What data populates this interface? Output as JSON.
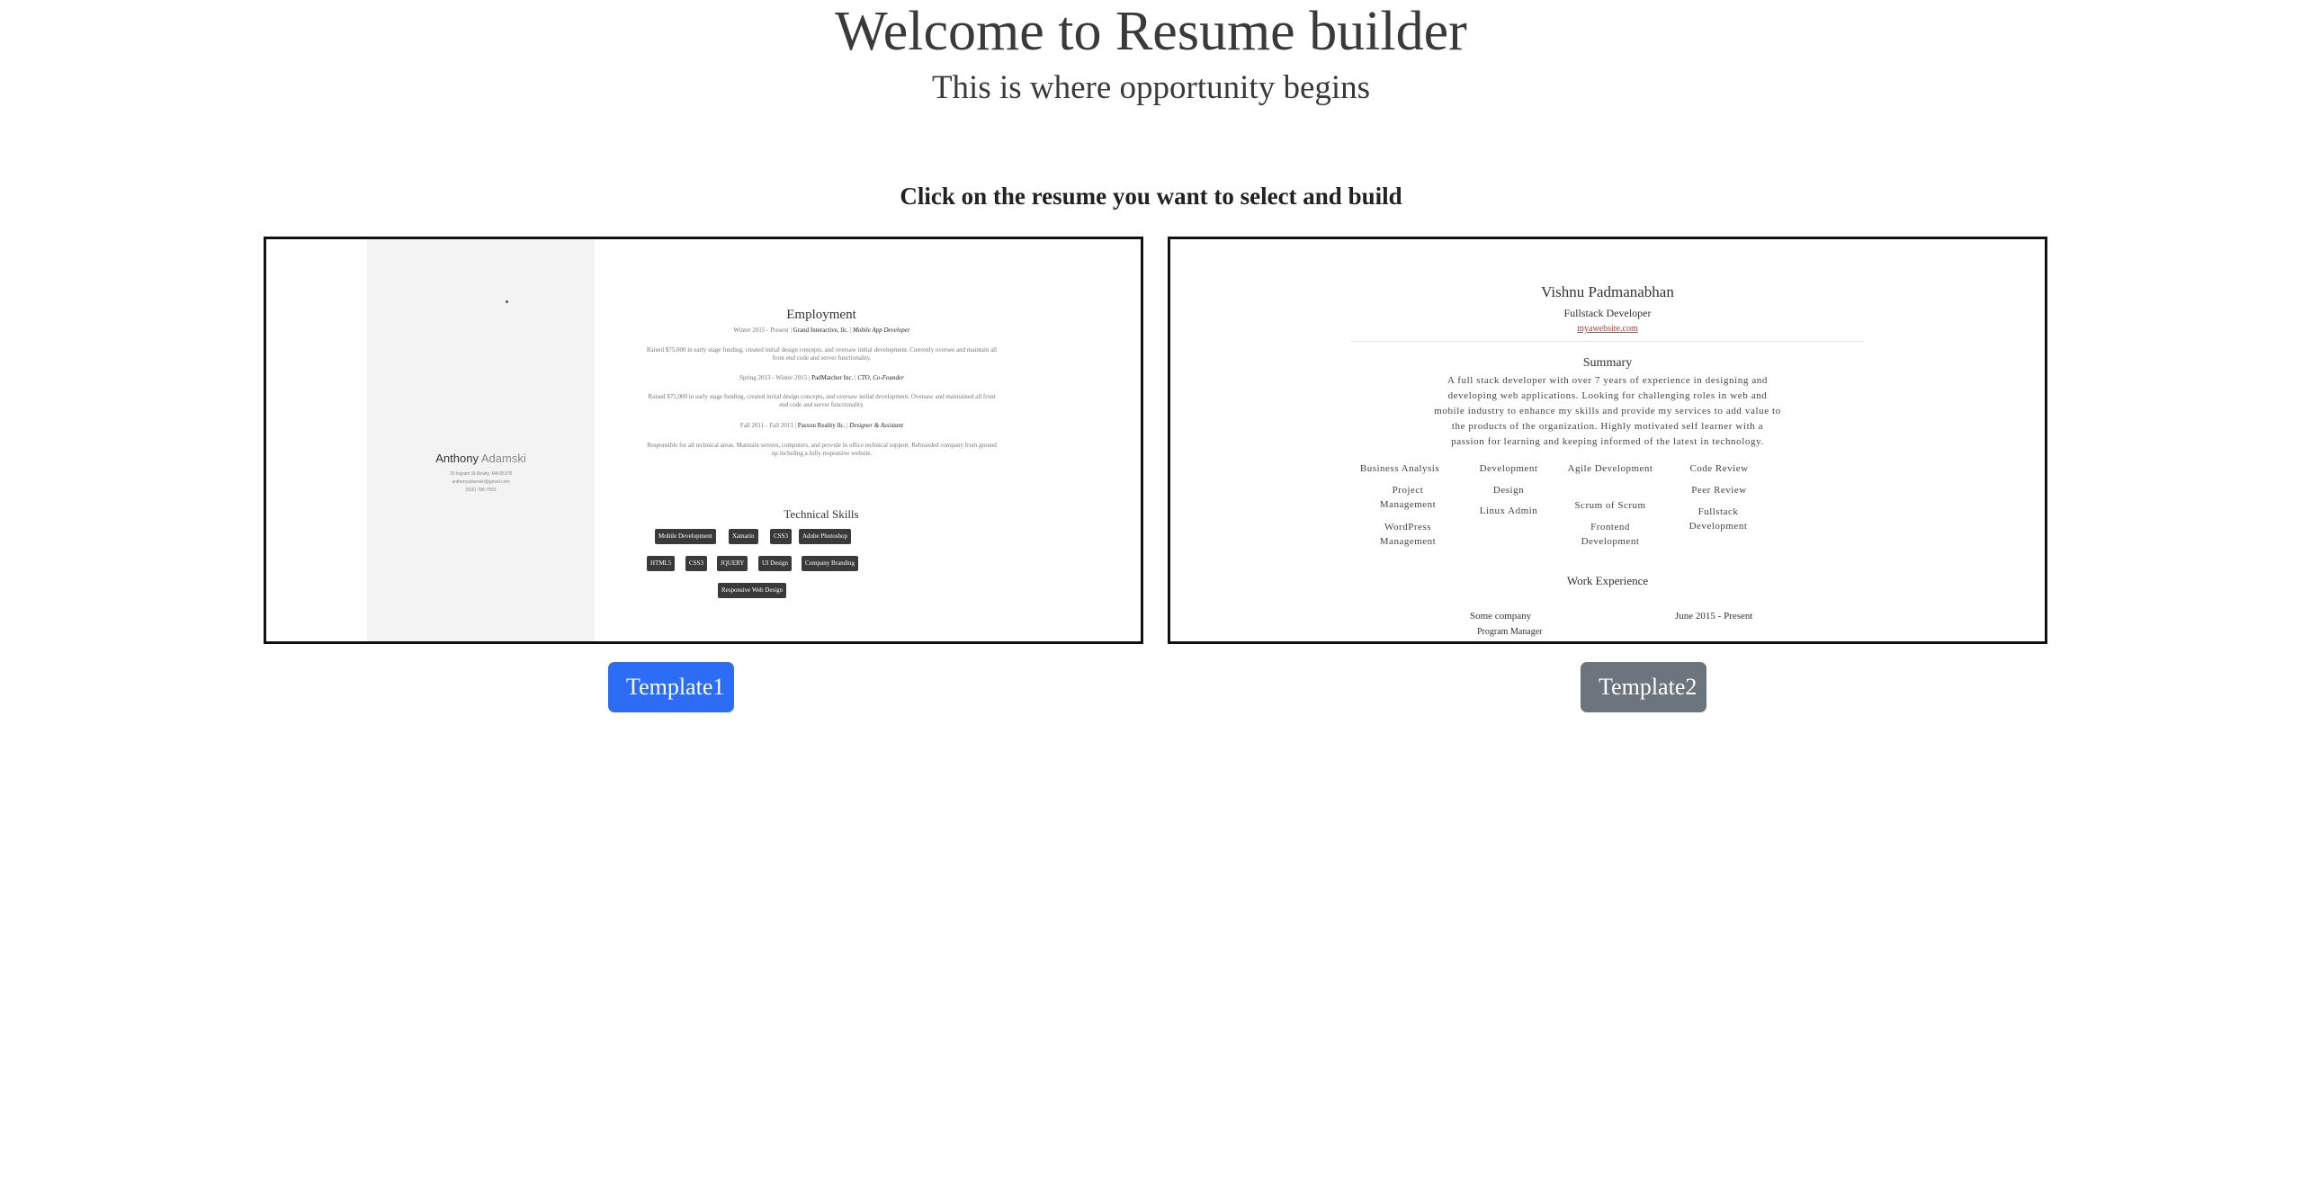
{
  "header": {
    "title": "Welcome to Resume builder",
    "subtitle": "This is where opportunity begins",
    "instruction": "Click on the resume you want to select and build"
  },
  "templates": [
    {
      "button_label": "Template1",
      "button_color": "#2d6cf5",
      "preview": {
        "first_name": "Anthony",
        "last_name": "Adamski",
        "contact": [
          "20 Ingram St Beatty, MA 85378",
          "anthonyadamski@gmail.com",
          "(555) 788-7555"
        ],
        "employment_heading": "Employment",
        "jobs": [
          {
            "period": "Winter 2015 - Present",
            "company": "Grand Interactive, llc.",
            "role": "Mobile App Developer",
            "desc": "Raised $75,000 in early stage funding, created initial design concepts, and oversaw initial development. Currently oversee and maintain all front end code and server functionality."
          },
          {
            "period": "Spring 2013 - Winter 2015",
            "company": "PadMatcher Inc.",
            "role": "CTO, Co-Founder",
            "desc": "Raised $75,000 in early stage funding, created initial design concepts, and oversaw initial development. Oversaw and maintained all front end code and server functionality."
          },
          {
            "period": "Fall 2011 - Fall 2013",
            "company": "Pasxon Reality llc.",
            "role": "Designer & Assistant",
            "desc": "Responsible for all technical areas. Maintain servers, computers, and provide in office technical support. Rebranded company from ground up including a fully responsive website."
          }
        ],
        "skills_heading": "Technical Skills",
        "skills": [
          "Mobile Development",
          "Xamarin",
          "CSS3",
          "Adobe Photoshop",
          "HTML5",
          "CSS3",
          "JQUERY",
          "UI Design",
          "Company Branding",
          "Responsive Web Design"
        ]
      }
    },
    {
      "button_label": "Template2",
      "button_color": "#6c747d",
      "preview": {
        "name": "Vishnu Padmanabhan",
        "role": "Fullstack Developer",
        "website": "myawebsite.com",
        "summary_heading": "Summary",
        "summary_lines": [
          "A full stack developer with over 7 years of experience in designing and",
          "developing web applications. Looking for challenging roles in web and",
          "mobile industry to enhance my skills and provide my services to add value to",
          "the products of the organization. Highly motivated self learner with a",
          "passion for learning and keeping informed of the latest in technology."
        ],
        "skills": [
          "Business Analysis",
          "Development",
          "Agile Development",
          "Code Review",
          "Project Management",
          "Design",
          "Scrum of Scrum",
          "Peer Review",
          "WordPress Management",
          "Linux Admin",
          "Frontend Development",
          "Fullstack Development"
        ],
        "work_heading": "Work Experience",
        "company": "Some company",
        "dates": "June 2015 - Present",
        "position": "Program Manager"
      }
    }
  ]
}
